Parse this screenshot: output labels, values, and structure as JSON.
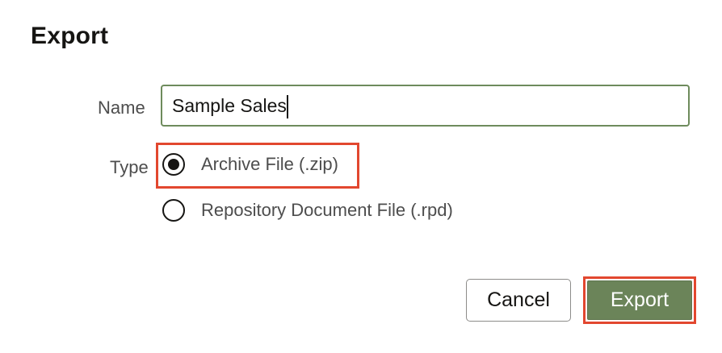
{
  "dialog": {
    "title": "Export"
  },
  "form": {
    "name_label": "Name",
    "name_value": "Sample Sales",
    "type_label": "Type",
    "type_options": [
      {
        "label": "Archive File (.zip)",
        "selected": true
      },
      {
        "label": "Repository Document File (.rpd)",
        "selected": false
      }
    ]
  },
  "actions": {
    "cancel_label": "Cancel",
    "export_label": "Export"
  },
  "colors": {
    "highlight": "#e2472f",
    "primary_button": "#6b8459",
    "input_border": "#6e8b5c"
  }
}
